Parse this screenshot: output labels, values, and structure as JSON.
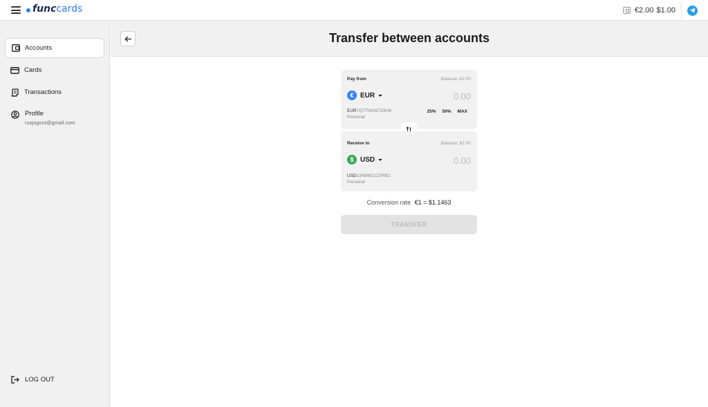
{
  "app": {
    "logo_func": "func",
    "logo_cards": "cards"
  },
  "topbar": {
    "eur_balance": "€2.00",
    "usd_balance": "$1.00",
    "icons": {
      "menu": "hamburger-icon",
      "wallet": "wallet-icon",
      "telegram": "telegram-icon"
    }
  },
  "sidebar": {
    "items": [
      {
        "label": "Accounts",
        "icon": "wallet-icon",
        "active": true
      },
      {
        "label": "Cards",
        "icon": "card-icon",
        "active": false
      },
      {
        "label": "Transactions",
        "icon": "receipt-icon",
        "active": false
      }
    ],
    "profile": {
      "label": "Profile",
      "email": "rusjogout@gmail.com",
      "icon": "user-circle-icon"
    },
    "logout_label": "LOG OUT"
  },
  "header": {
    "title": "Transfer between accounts",
    "back_icon": "arrow-left-icon"
  },
  "pay_from": {
    "label": "Pay from",
    "balance": "Balance: €2.00",
    "currency_symbol": "€",
    "currency": "EUR",
    "badge_color": "#3b82f6",
    "amount_placeholder": "0.00",
    "account_prefix": "EUR",
    "account_rest": "7Q7TNKM7Z9H6",
    "account_type": "Personal",
    "percentages": [
      "25%",
      "50%",
      "MAX"
    ]
  },
  "receive_to": {
    "label": "Receive to",
    "balance": "Balance: $1.00",
    "currency_symbol": "$",
    "currency": "USD",
    "badge_color": "#3aa757",
    "amount_placeholder": "0.00",
    "account_prefix": "USD",
    "account_rest": "18N6M21ZXRB1",
    "account_type": "Personal"
  },
  "conversion": {
    "label": "Conversion rate",
    "rate": "€1 = $1.1463"
  },
  "transfer_button": "TRANSFER",
  "colors": {
    "brand_blue": "#2f7ff0",
    "telegram": "#2aa0e0",
    "panel_bg": "#f1f1f1"
  }
}
